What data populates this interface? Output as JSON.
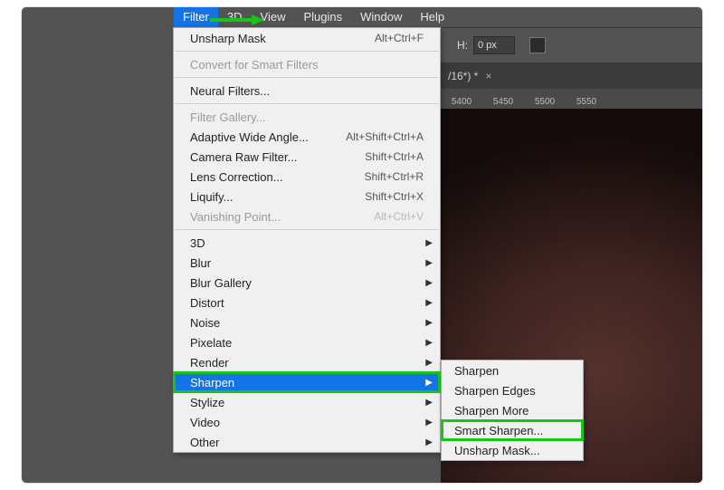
{
  "menubar": {
    "items": [
      "Filter",
      "3D",
      "View",
      "Plugins",
      "Window",
      "Help"
    ],
    "active": "Filter"
  },
  "options_bar": {
    "h_label": "H:",
    "h_value": "0 px"
  },
  "document_tab": {
    "title": "/16*) *",
    "close_glyph": "×"
  },
  "ruler_ticks": [
    "5400",
    "5450",
    "5500",
    "5550"
  ],
  "filter_menu": {
    "last": {
      "label": "Unsharp Mask",
      "shortcut": "Alt+Ctrl+F"
    },
    "convert": "Convert for Smart Filters",
    "neural": "Neural Filters...",
    "gallery": "Filter Gallery...",
    "adaptive": {
      "label": "Adaptive Wide Angle...",
      "shortcut": "Alt+Shift+Ctrl+A"
    },
    "camera": {
      "label": "Camera Raw Filter...",
      "shortcut": "Shift+Ctrl+A"
    },
    "lens": {
      "label": "Lens Correction...",
      "shortcut": "Shift+Ctrl+R"
    },
    "liquify": {
      "label": "Liquify...",
      "shortcut": "Shift+Ctrl+X"
    },
    "vanishing": {
      "label": "Vanishing Point...",
      "shortcut": "Alt+Ctrl+V"
    },
    "subs": [
      "3D",
      "Blur",
      "Blur Gallery",
      "Distort",
      "Noise",
      "Pixelate",
      "Render",
      "Sharpen",
      "Stylize",
      "Video",
      "Other"
    ]
  },
  "sharpen_submenu": [
    "Sharpen",
    "Sharpen Edges",
    "Sharpen More",
    "Smart Sharpen...",
    "Unsharp Mask..."
  ],
  "highlight": {
    "menu": "Sharpen",
    "sub": "Smart Sharpen..."
  }
}
